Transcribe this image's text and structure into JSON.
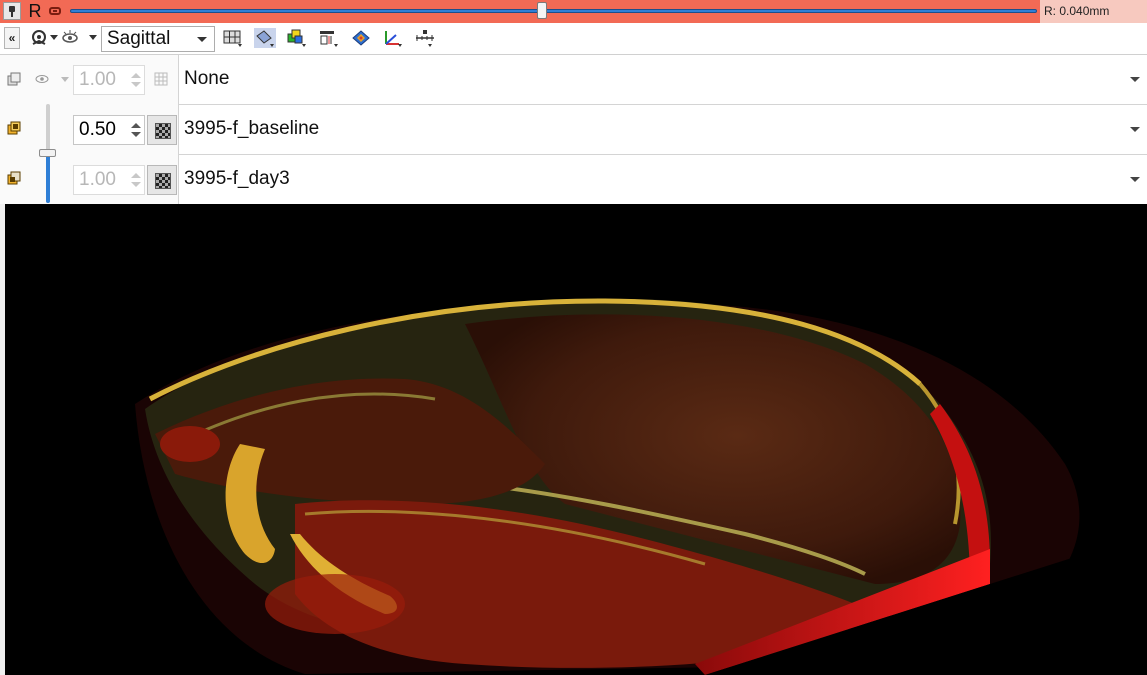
{
  "slice_bar": {
    "view_letter": "R",
    "offset_label": "R: 0.040mm",
    "slider_position": 0.49,
    "bar_color": "#f26a55"
  },
  "toolbar": {
    "orientation_value": "Sagittal",
    "icons": [
      "pin-icon",
      "link-icon",
      "collapse-icon",
      "visibility-icon",
      "eye-icon",
      "layout-icon",
      "reformat-icon",
      "color-icon",
      "crosshair-icon",
      "model-icon",
      "transform-icon",
      "ruler-icon"
    ]
  },
  "layers": {
    "label": {
      "opacity": "1.00",
      "volume": "None"
    },
    "foreground": {
      "opacity": "0.50",
      "volume": "3995-f_baseline"
    },
    "background": {
      "opacity": "1.00",
      "volume": "3995-f_day3"
    },
    "foreground_opacity_slider": 0.5
  },
  "colors": {
    "accent_blue": "#2f7fd6",
    "viewport_bg": "#000000"
  }
}
